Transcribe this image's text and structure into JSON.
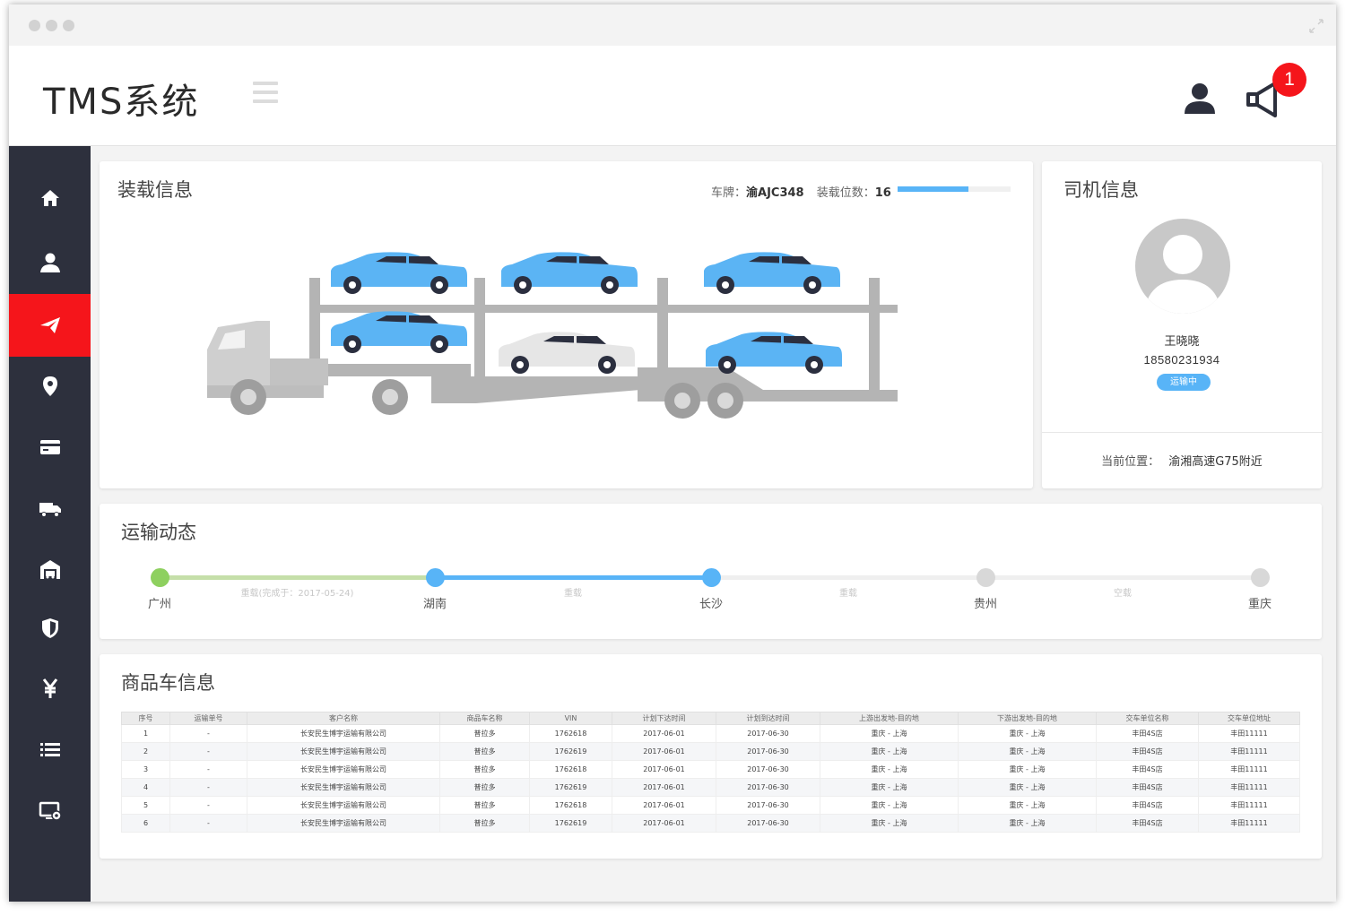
{
  "app": {
    "title": "TMS系统"
  },
  "header": {
    "notification_count": "1"
  },
  "sidebar": {
    "items": [
      {
        "icon": "home-icon"
      },
      {
        "icon": "user-icon"
      },
      {
        "icon": "paper-plane-icon",
        "active": true
      },
      {
        "icon": "location-pin-icon"
      },
      {
        "icon": "credit-card-icon"
      },
      {
        "icon": "truck-icon"
      },
      {
        "icon": "garage-icon"
      },
      {
        "icon": "shield-icon"
      },
      {
        "icon": "yen-icon"
      },
      {
        "icon": "list-icon"
      },
      {
        "icon": "monitor-settings-icon"
      }
    ]
  },
  "load_info": {
    "title": "装载信息",
    "plate_label": "车牌：",
    "plate": "渝AJC348",
    "slots_label": "装载位数：",
    "slots": "16",
    "load_fraction": 0.63,
    "car_colors": {
      "loaded": "#5bb4f4",
      "empty": "#e6e6e6",
      "truck": "#b4b4b4"
    }
  },
  "driver": {
    "title": "司机信息",
    "name": "王晓晓",
    "phone": "18580231934",
    "status": "运输中",
    "location_label": "当前位置：",
    "location": "渝湘高速G75附近"
  },
  "transport": {
    "title": "运输动态",
    "nodes": [
      "广州",
      "湖南",
      "长沙",
      "贵州",
      "重庆"
    ],
    "segments": [
      "重载(完成于：2017-05-24)",
      "重载",
      "重载",
      "空载"
    ],
    "colors": {
      "done": "#8ed05f",
      "active": "#58b4f7",
      "pending": "#d8d8d8"
    }
  },
  "goods": {
    "title": "商品车信息",
    "headers": [
      "序号",
      "运输单号",
      "客户名称",
      "商品车名称",
      "VIN",
      "计划下达时间",
      "计划到达时间",
      "上游出发地-目的地",
      "下游出发地-目的地",
      "交车单位名称",
      "交车单位地址"
    ],
    "rows": [
      [
        "1",
        "-",
        "长安民生博宇运输有限公司",
        "普拉多",
        "1762618",
        "2017-06-01",
        "2017-06-30",
        "重庆 - 上海",
        "重庆 - 上海",
        "丰田4S店",
        "丰田11111"
      ],
      [
        "2",
        "-",
        "长安民生博宇运输有限公司",
        "普拉多",
        "1762619",
        "2017-06-01",
        "2017-06-30",
        "重庆 - 上海",
        "重庆 - 上海",
        "丰田4S店",
        "丰田11111"
      ],
      [
        "3",
        "-",
        "长安民生博宇运输有限公司",
        "普拉多",
        "1762618",
        "2017-06-01",
        "2017-06-30",
        "重庆 - 上海",
        "重庆 - 上海",
        "丰田4S店",
        "丰田11111"
      ],
      [
        "4",
        "-",
        "长安民生博宇运输有限公司",
        "普拉多",
        "1762619",
        "2017-06-01",
        "2017-06-30",
        "重庆 - 上海",
        "重庆 - 上海",
        "丰田4S店",
        "丰田11111"
      ],
      [
        "5",
        "-",
        "长安民生博宇运输有限公司",
        "普拉多",
        "1762618",
        "2017-06-01",
        "2017-06-30",
        "重庆 - 上海",
        "重庆 - 上海",
        "丰田4S店",
        "丰田11111"
      ],
      [
        "6",
        "-",
        "长安民生博宇运输有限公司",
        "普拉多",
        "1762619",
        "2017-06-01",
        "2017-06-30",
        "重庆 - 上海",
        "重庆 - 上海",
        "丰田4S店",
        "丰田11111"
      ]
    ]
  }
}
